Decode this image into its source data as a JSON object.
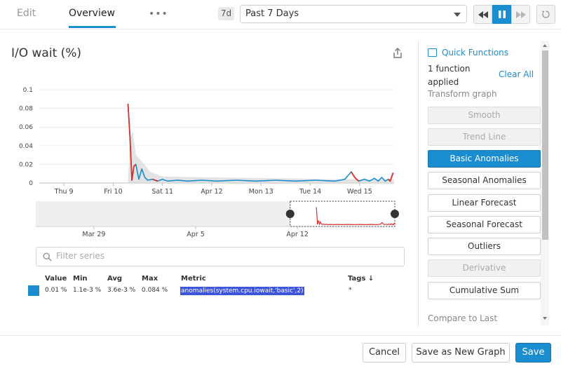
{
  "tabs": [
    {
      "label": "Edit"
    },
    {
      "label": "Overview"
    }
  ],
  "more_label": "•••",
  "timeframe": {
    "span_badge": "7d",
    "selected": "Past 7 Days"
  },
  "playback": {
    "rewind_icon": "rewind-icon",
    "pause_icon": "pause-icon",
    "forward_icon": "fast-forward-icon",
    "reset_icon": "reset-icon"
  },
  "graph": {
    "title": "I/O wait (%)",
    "share_icon": "share-icon"
  },
  "chart_data": {
    "type": "line",
    "title": "I/O wait (%)",
    "ylim": [
      0,
      0.1
    ],
    "y_ticks": [
      "0.1",
      "0.08",
      "0.06",
      "0.04",
      "0.02",
      "0"
    ],
    "x_ticks": [
      "Thu 9",
      "Fri 10",
      "Sat 11",
      "Apr 12",
      "Mon 13",
      "Tue 14",
      "Wed 15"
    ],
    "x_tick_positions_days": [
      0.5,
      1.5,
      2.5,
      3.5,
      4.5,
      5.5,
      6.5
    ],
    "x_range_days": [
      0,
      7.2
    ],
    "grid": true,
    "colors": {
      "metric": "#1a8dd0",
      "anomaly": "#d9302c",
      "band": "#d9d9d9"
    },
    "series": [
      {
        "name": "anomalies(system.cpu.iowait,'basic',2)",
        "points": [
          [
            1.8,
            0.085
          ],
          [
            1.84,
            0.05
          ],
          [
            1.88,
            0.003
          ],
          [
            1.92,
            0.018
          ],
          [
            1.96,
            0.02
          ],
          [
            2.02,
            0.004
          ],
          [
            2.08,
            0.015
          ],
          [
            2.14,
            0.006
          ],
          [
            2.2,
            0.003
          ],
          [
            2.3,
            0.004
          ],
          [
            2.4,
            0.002
          ],
          [
            2.5,
            0.004
          ],
          [
            2.6,
            0.002
          ],
          [
            2.8,
            0.003
          ],
          [
            3.0,
            0.002
          ],
          [
            3.3,
            0.003
          ],
          [
            3.6,
            0.002
          ],
          [
            4.0,
            0.003
          ],
          [
            4.4,
            0.002
          ],
          [
            4.8,
            0.003
          ],
          [
            5.2,
            0.002
          ],
          [
            5.6,
            0.003
          ],
          [
            6.0,
            0.002
          ],
          [
            6.2,
            0.004
          ],
          [
            6.33,
            0.012
          ],
          [
            6.4,
            0.006
          ],
          [
            6.48,
            0.002
          ],
          [
            6.6,
            0.004
          ],
          [
            6.7,
            0.002
          ],
          [
            6.8,
            0.005
          ],
          [
            6.88,
            0.002
          ],
          [
            6.95,
            0.006
          ],
          [
            7.02,
            0.002
          ],
          [
            7.08,
            0.004
          ],
          [
            7.12,
            0.002
          ],
          [
            7.18,
            0.011
          ]
        ],
        "anomalous_ranges_days": [
          [
            1.8,
            1.98
          ],
          [
            2.3,
            2.42
          ],
          [
            6.22,
            6.5
          ],
          [
            6.72,
            6.85
          ],
          [
            7.05,
            7.2
          ]
        ],
        "bounds_band": [
          [
            1.8,
            0.0,
            0.0
          ],
          [
            1.84,
            0.0,
            0.05
          ],
          [
            1.9,
            0.0,
            0.055
          ],
          [
            1.96,
            0.0,
            0.03
          ],
          [
            2.1,
            0.0,
            0.022
          ],
          [
            2.25,
            0.0,
            0.012
          ],
          [
            2.5,
            0.0,
            0.007
          ],
          [
            3.5,
            0.0,
            0.006
          ],
          [
            5.0,
            0.0,
            0.005
          ],
          [
            6.0,
            0.0,
            0.004
          ],
          [
            7.2,
            0.0,
            0.004
          ]
        ]
      }
    ],
    "navigator": {
      "x_ticks": [
        "Mar 29",
        "Apr 5",
        "Apr 12"
      ],
      "x_tick_positions_days": [
        -13.5,
        -6.5,
        0.5
      ],
      "x_range_days": [
        -17.5,
        7.2
      ],
      "selection_days": [
        0,
        7.2
      ]
    }
  },
  "filter": {
    "placeholder": "Filter series",
    "value": ""
  },
  "legend": {
    "headers": [
      "Value",
      "Min",
      "Avg",
      "Max",
      "Metric",
      "Tags ↓"
    ],
    "row": {
      "value": "0.01 %",
      "min": "1.1e-3 %",
      "avg": "3.6e-3 %",
      "max": "0.084 %",
      "metric": "anomalies(system.cpu.iowait,'basic',2)",
      "tags": "*"
    }
  },
  "functions": {
    "header": "Quick Functions",
    "count": "1 function applied",
    "clear_all": "Clear All",
    "transform": "Transform graph",
    "buttons": [
      {
        "label": "Smooth",
        "state": "disabled"
      },
      {
        "label": "Trend Line",
        "state": "disabled"
      },
      {
        "label": "Basic Anomalies",
        "state": "active"
      },
      {
        "label": "Seasonal Anomalies",
        "state": "normal"
      },
      {
        "label": "Linear Forecast",
        "state": "normal"
      },
      {
        "label": "Seasonal Forecast",
        "state": "normal"
      },
      {
        "label": "Outliers",
        "state": "normal"
      },
      {
        "label": "Derivative",
        "state": "disabled"
      },
      {
        "label": "Cumulative Sum",
        "state": "normal"
      }
    ],
    "compare": "Compare to Last"
  },
  "footer": {
    "cancel": "Cancel",
    "save_as_new": "Save as New Graph",
    "save": "Save"
  }
}
